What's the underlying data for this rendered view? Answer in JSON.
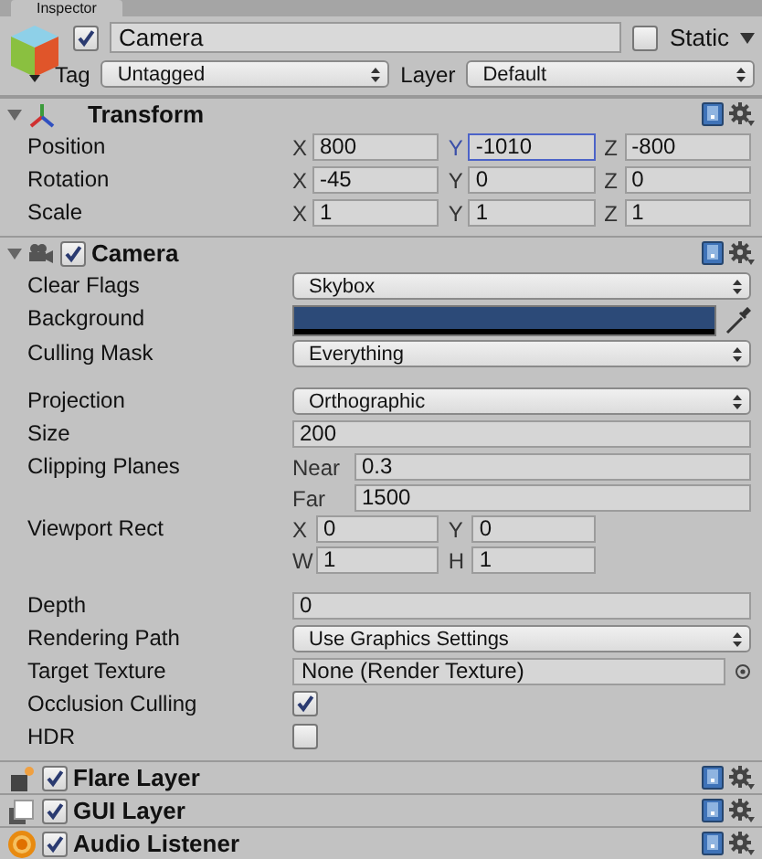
{
  "tab": {
    "label": "Inspector"
  },
  "object": {
    "active": true,
    "name": "Camera",
    "static": false,
    "static_label": "Static",
    "tag_label": "Tag",
    "tag": "Untagged",
    "layer_label": "Layer",
    "layer": "Default"
  },
  "components": [
    {
      "kind": "transform",
      "title": "Transform",
      "expanded": true,
      "rows": [
        {
          "kind": "vector",
          "label": "Position",
          "fields": [
            {
              "axis": "X",
              "value": "800",
              "focused": false
            },
            {
              "axis": "Y",
              "value": "-1010",
              "focused": true
            },
            {
              "axis": "Z",
              "value": "-800",
              "focused": false
            }
          ]
        },
        {
          "kind": "vector",
          "label": "Rotation",
          "fields": [
            {
              "axis": "X",
              "value": "-45",
              "focused": false
            },
            {
              "axis": "Y",
              "value": "0",
              "focused": false
            },
            {
              "axis": "Z",
              "value": "0",
              "focused": false
            }
          ]
        },
        {
          "kind": "vector",
          "label": "Scale",
          "fields": [
            {
              "axis": "X",
              "value": "1",
              "focused": false
            },
            {
              "axis": "Y",
              "value": "1",
              "focused": false
            },
            {
              "axis": "Z",
              "value": "1",
              "focused": false
            }
          ]
        }
      ]
    },
    {
      "kind": "camera",
      "title": "Camera",
      "enabled": true,
      "expanded": true,
      "rows": [
        {
          "kind": "dropdown",
          "label": "Clear Flags",
          "value": "Skybox"
        },
        {
          "kind": "color",
          "label": "Background",
          "color": "#2c4a78"
        },
        {
          "kind": "dropdown",
          "label": "Culling Mask",
          "value": "Everything"
        },
        {
          "kind": "dropdown",
          "label": "Projection",
          "value": "Orthographic",
          "spaced": true
        },
        {
          "kind": "text",
          "label": "Size",
          "value": "200"
        },
        {
          "kind": "stack",
          "label": "Clipping Planes",
          "fields": [
            {
              "axis": "Near",
              "value": "0.3"
            },
            {
              "axis": "Far",
              "value": "1500"
            }
          ]
        },
        {
          "kind": "grid",
          "label": "Viewport Rect",
          "fields": [
            {
              "axis": "X",
              "value": "0"
            },
            {
              "axis": "Y",
              "value": "0"
            },
            {
              "axis": "W",
              "value": "1"
            },
            {
              "axis": "H",
              "value": "1"
            }
          ]
        },
        {
          "kind": "text",
          "label": "Depth",
          "value": "0",
          "spaced": true
        },
        {
          "kind": "dropdown",
          "label": "Rendering Path",
          "value": "Use Graphics Settings"
        },
        {
          "kind": "object",
          "label": "Target Texture",
          "value": "None (Render Texture)"
        },
        {
          "kind": "checkbox",
          "label": "Occlusion Culling",
          "checked": true
        },
        {
          "kind": "checkbox",
          "label": "HDR",
          "checked": false
        }
      ]
    },
    {
      "kind": "flare",
      "title": "Flare Layer",
      "enabled": true
    },
    {
      "kind": "gui",
      "title": "GUI Layer",
      "enabled": true
    },
    {
      "kind": "audio",
      "title": "Audio Listener",
      "enabled": true
    }
  ]
}
